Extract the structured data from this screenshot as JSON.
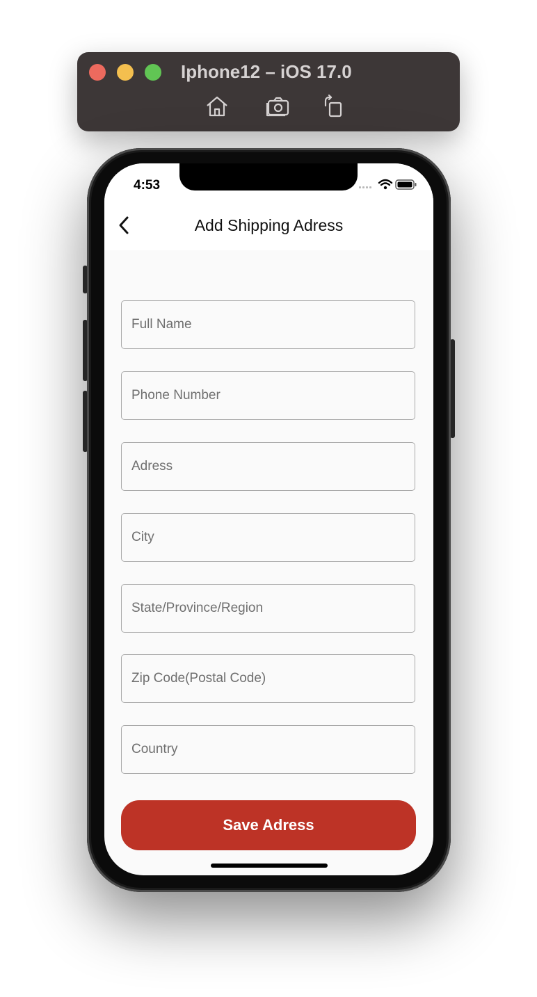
{
  "simulator": {
    "title": "Iphone12 – iOS 17.0",
    "toolbar": [
      "home-icon",
      "screenshot-icon",
      "rotate-icon"
    ]
  },
  "status_bar": {
    "time": "4:53",
    "icons": [
      "signal-icon",
      "wifi-icon",
      "battery-icon"
    ]
  },
  "header": {
    "title": "Add Shipping Adress",
    "back_icon": "chevron-left-icon"
  },
  "form": {
    "fields": [
      {
        "placeholder": "Full Name",
        "value": ""
      },
      {
        "placeholder": "Phone Number",
        "value": ""
      },
      {
        "placeholder": "Adress",
        "value": ""
      },
      {
        "placeholder": "City",
        "value": ""
      },
      {
        "placeholder": "State/Province/Region",
        "value": ""
      },
      {
        "placeholder": "Zip Code(Postal Code)",
        "value": ""
      },
      {
        "placeholder": "Country",
        "value": ""
      }
    ],
    "submit_label": "Save Adress"
  },
  "colors": {
    "primary": "#bd3326",
    "background": "#fafafa",
    "field_border": "#a9a9a9"
  }
}
